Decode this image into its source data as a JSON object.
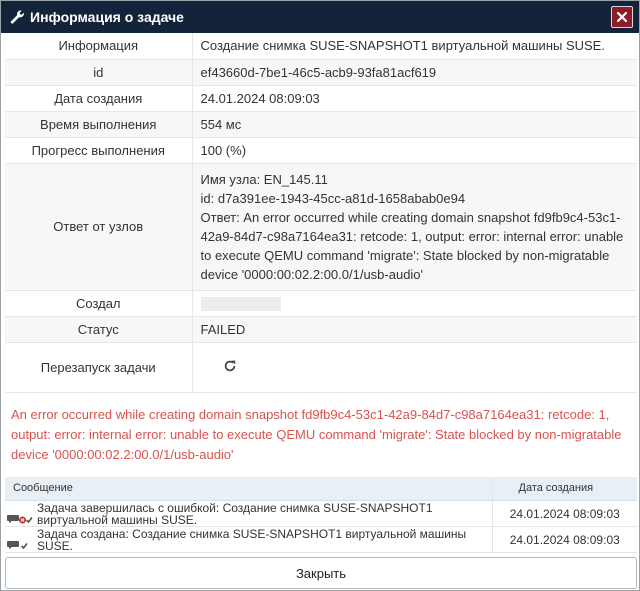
{
  "dialog": {
    "title": "Информация о задаче",
    "close_label": "Закрыть"
  },
  "info_rows": {
    "info": {
      "label": "Информация",
      "value": "Создание снимка SUSE-SNAPSHOT1 виртуальной машины SUSE."
    },
    "id": {
      "label": "id",
      "value": "ef43660d-7be1-46c5-acb9-93fa81acf619"
    },
    "created": {
      "label": "Дата создания",
      "value": "24.01.2024 08:09:03"
    },
    "duration": {
      "label": "Время выполнения",
      "value": "554 мс"
    },
    "progress": {
      "label": "Прогресс выполнения",
      "value": "100 (%)"
    },
    "node_response": {
      "label": "Ответ от узлов",
      "node_name": "Имя узла: EN_145.11",
      "node_id": "id: d7a391ee-1943-45cc-a81d-1658abab0e94",
      "answer": "Ответ: An error occurred while creating domain snapshot fd9fb9c4-53c1-42a9-84d7-c98a7164ea31: retcode: 1, output: error: internal error: unable to execute QEMU command 'migrate': State blocked by non-migratable device '0000:00:02.2:00.0/1/usb-audio'"
    },
    "creator": {
      "label": "Создал"
    },
    "status": {
      "label": "Статус",
      "value": "FAILED"
    },
    "restart": {
      "label": "Перезапуск задачи"
    }
  },
  "error_message": "An error occurred while creating domain snapshot fd9fb9c4-53c1-42a9-84d7-c98a7164ea31: retcode: 1, output: error: internal error: unable to execute QEMU command 'migrate': State blocked by non-migratable device '0000:00:02.2:00.0/1/usb-audio'",
  "messages_table": {
    "headers": {
      "message": "Сообщение",
      "date": "Дата создания"
    },
    "rows": [
      {
        "text": "Задача завершилась с ошибкой: Создание снимка SUSE-SNAPSHOT1 виртуальной машины SUSE.",
        "date": "24.01.2024 08:09:03",
        "icon": "comment-error-icon"
      },
      {
        "text": "Задача создана: Создание снимка SUSE-SNAPSHOT1 виртуальной машины SUSE.",
        "date": "24.01.2024 08:09:03",
        "icon": "comment-check-icon"
      }
    ]
  },
  "colors": {
    "titlebar": "#13243a",
    "close_button": "#8b1c2a",
    "error_text": "#d9534f",
    "table_header": "#e8eff5"
  }
}
